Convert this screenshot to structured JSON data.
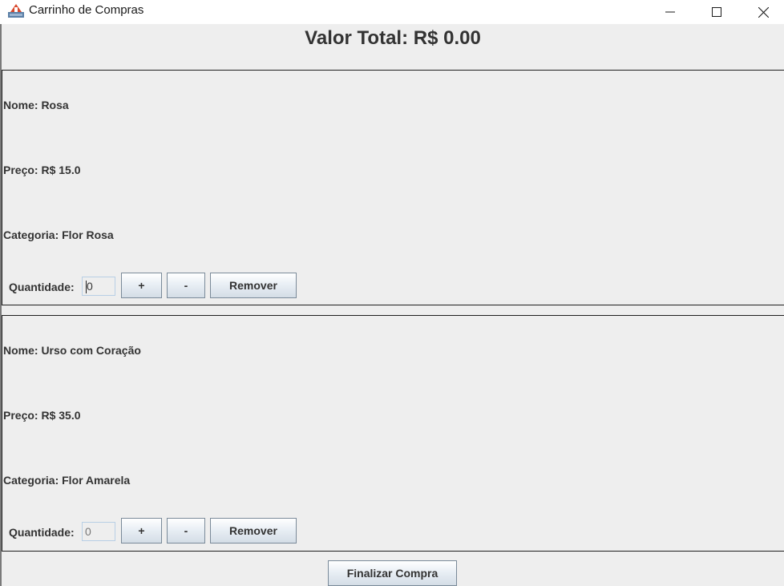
{
  "window": {
    "title": "Carrinho de Compras",
    "icon": "java-app-icon"
  },
  "cart": {
    "total_label": "Valor Total: R$ 0.00",
    "finalize_label": "Finalizar Compra"
  },
  "products": [
    {
      "nome": "Nome: Rosa",
      "preco": "Preço: R$ 15.0",
      "categoria": "Categoria: Flor Rosa",
      "quantidade_label": "Quantidade:",
      "quantidade_value": "0",
      "plus_label": "+",
      "minus_label": "-",
      "remove_label": "Remover"
    },
    {
      "nome": "Nome: Urso com Coração",
      "preco": "Preço: R$ 35.0",
      "categoria": "Categoria: Flor Amarela",
      "quantidade_label": "Quantidade:",
      "quantidade_value": "0",
      "plus_label": "+",
      "minus_label": "-",
      "remove_label": "Remover"
    }
  ]
}
